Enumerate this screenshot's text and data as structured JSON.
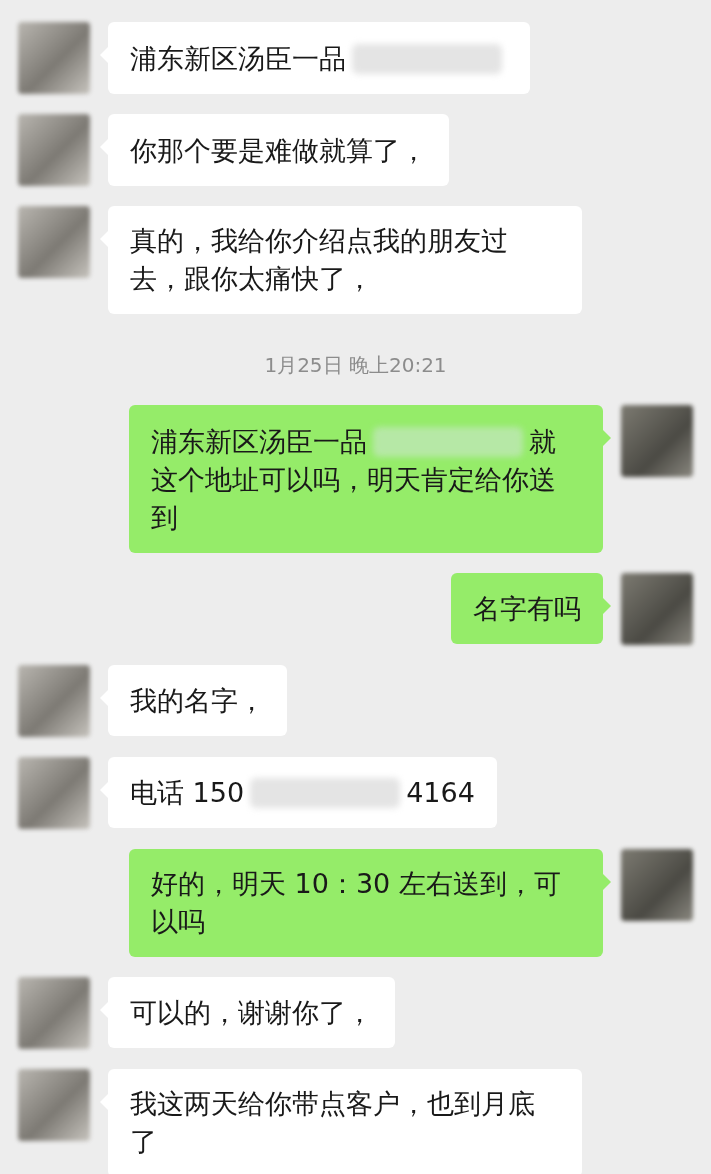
{
  "messages": [
    {
      "kind": "incoming",
      "parts": [
        {
          "kind": "text",
          "text": "浦东新区汤臣一品"
        },
        {
          "kind": "redacted"
        }
      ]
    },
    {
      "kind": "incoming",
      "parts": [
        {
          "kind": "text",
          "text": "你那个要是难做就算了，"
        }
      ]
    },
    {
      "kind": "incoming",
      "parts": [
        {
          "kind": "text",
          "text": "真的，我给你介绍点我的朋友过去，跟你太痛快了，"
        }
      ]
    },
    {
      "kind": "time",
      "text": "1月25日 晚上20:21"
    },
    {
      "kind": "outgoing",
      "parts": [
        {
          "kind": "text",
          "text": "浦东新区汤臣一品"
        },
        {
          "kind": "redacted"
        },
        {
          "kind": "text",
          "text": "就"
        },
        {
          "kind": "text",
          "text": "这个地址可以吗，明天肯定给你送到"
        }
      ]
    },
    {
      "kind": "outgoing",
      "parts": [
        {
          "kind": "text",
          "text": "名字有吗"
        }
      ]
    },
    {
      "kind": "incoming",
      "parts": [
        {
          "kind": "text",
          "text": "我的名字，"
        }
      ]
    },
    {
      "kind": "incoming",
      "parts": [
        {
          "kind": "text",
          "text": "电话 150"
        },
        {
          "kind": "redacted"
        },
        {
          "kind": "text",
          "text": "4164"
        }
      ]
    },
    {
      "kind": "outgoing",
      "parts": [
        {
          "kind": "text",
          "text": "好的，明天 10：30 左右送到，可以吗"
        }
      ]
    },
    {
      "kind": "incoming",
      "parts": [
        {
          "kind": "text",
          "text": "可以的，谢谢你了，"
        }
      ]
    },
    {
      "kind": "incoming",
      "parts": [
        {
          "kind": "text",
          "text": "我这两天给你带点客户，也到月底了"
        }
      ]
    }
  ]
}
